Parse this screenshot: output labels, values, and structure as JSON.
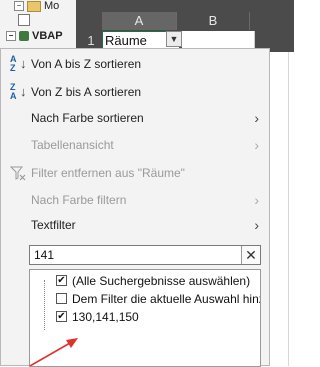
{
  "tree": {
    "item1": "Mo",
    "item2": "",
    "item3": "VBAP"
  },
  "sheet": {
    "columns": [
      "A",
      "B"
    ],
    "row_number": "1",
    "cell_a1": "Räume"
  },
  "menu": {
    "sort_az": "Von A bis Z sortieren",
    "sort_za": "Von Z bis A sortieren",
    "sort_by_color": "Nach Farbe sortieren",
    "sheet_view": "Tabellenansicht",
    "clear_filter": "Filter entfernen aus \"Räume\"",
    "filter_by_color": "Nach Farbe filtern",
    "text_filter": "Textfilter"
  },
  "search": {
    "value": "141"
  },
  "list": {
    "items": [
      {
        "label": "(Alle Suchergebnisse auswählen)",
        "checked": true
      },
      {
        "label": "Dem Filter die aktuelle Auswahl hinz",
        "checked": false
      },
      {
        "label": "130,141,150",
        "checked": true
      }
    ]
  },
  "colors": {
    "annotation_arrow": "#e0312c",
    "sheet_background": "#4b4b4b",
    "menu_background": "#f3f3f3"
  }
}
